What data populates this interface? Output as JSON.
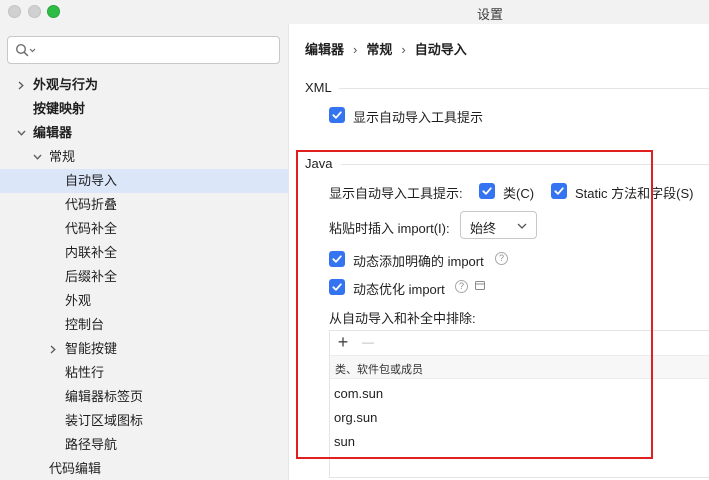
{
  "window": {
    "title": "设置"
  },
  "search": {
    "placeholder": ""
  },
  "tree": {
    "items": [
      {
        "label": "外观与行为",
        "bold": true,
        "arrow": "right"
      },
      {
        "label": "按键映射",
        "bold": true,
        "arrow": ""
      },
      {
        "label": "编辑器",
        "bold": true,
        "arrow": "down"
      },
      {
        "label": "常规",
        "bold": false,
        "arrow": "down"
      },
      {
        "label": "自动导入",
        "bold": false,
        "arrow": "",
        "selected": true
      },
      {
        "label": "代码折叠",
        "bold": false,
        "arrow": ""
      },
      {
        "label": "代码补全",
        "bold": false,
        "arrow": ""
      },
      {
        "label": "内联补全",
        "bold": false,
        "arrow": ""
      },
      {
        "label": "后缀补全",
        "bold": false,
        "arrow": ""
      },
      {
        "label": "外观",
        "bold": false,
        "arrow": ""
      },
      {
        "label": "控制台",
        "bold": false,
        "arrow": ""
      },
      {
        "label": "智能按键",
        "bold": false,
        "arrow": "right"
      },
      {
        "label": "粘性行",
        "bold": false,
        "arrow": ""
      },
      {
        "label": "编辑器标签页",
        "bold": false,
        "arrow": ""
      },
      {
        "label": "装订区域图标",
        "bold": false,
        "arrow": ""
      },
      {
        "label": "路径导航",
        "bold": false,
        "arrow": ""
      },
      {
        "label": "代码编辑",
        "bold": false,
        "arrow": ""
      }
    ]
  },
  "breadcrumb": {
    "part1": "编辑器",
    "part2": "常规",
    "part3": "自动导入",
    "separator": "›"
  },
  "xml": {
    "title": "XML",
    "show_tooltip_label": "显示自动导入工具提示",
    "show_tooltip_checked": true
  },
  "java": {
    "title": "Java",
    "show_tooltip_label": "显示自动导入工具提示:",
    "classes_label": "类(C)",
    "classes_checked": true,
    "static_label": "Static 方法和字段(S)",
    "static_checked": true,
    "paste_label": "粘贴时插入 import(I):",
    "paste_value": "始终",
    "add_unambiguous_label": "动态添加明确的 import",
    "add_unambiguous_checked": true,
    "optimize_label": "动态优化 import",
    "optimize_checked": true,
    "exclude_label": "从自动导入和补全中排除:",
    "exclude_header": "类、软件包或成员",
    "exclude_add": "+",
    "exclude_remove": "—",
    "exclude_items": [
      "com.sun",
      "org.sun",
      "sun"
    ]
  },
  "colors": {
    "accent": "#3574f0",
    "selection": "#dbe6f8",
    "highlight": "#e02020"
  }
}
